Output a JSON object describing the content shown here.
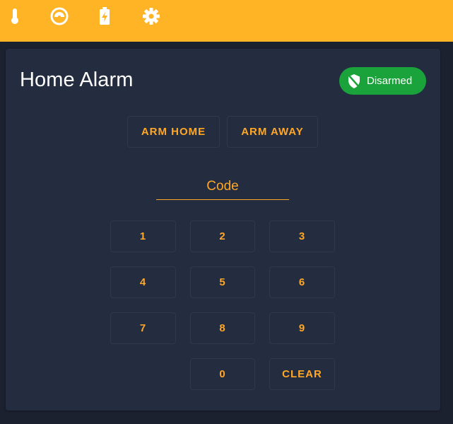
{
  "topbar": {
    "icons": [
      "thermometer-icon",
      "gauge-icon",
      "battery-charging-icon",
      "gear-icon"
    ]
  },
  "card": {
    "title": "Home Alarm",
    "status": {
      "label": "Disarmed",
      "icon": "shield-off-icon",
      "color": "#1aa33a"
    }
  },
  "actions": {
    "arm_home": "ARM HOME",
    "arm_away": "ARM AWAY"
  },
  "code": {
    "placeholder": "Code",
    "value": ""
  },
  "keypad": {
    "k1": "1",
    "k2": "2",
    "k3": "3",
    "k4": "4",
    "k5": "5",
    "k6": "6",
    "k7": "7",
    "k8": "8",
    "k9": "9",
    "k0": "0",
    "clear": "CLEAR"
  },
  "colors": {
    "accent": "#ffa726",
    "header": "#ffb425",
    "card": "#242c40",
    "background": "#1c2130"
  }
}
